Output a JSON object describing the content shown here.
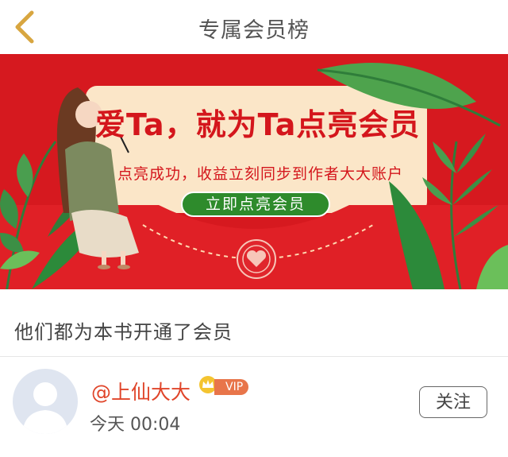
{
  "header": {
    "title": "专属会员榜",
    "back_icon": "chevron-left-icon"
  },
  "banner": {
    "headline": "爱Ta，就为Ta点亮会员",
    "subtext": "点亮成功，收益立刻同步到作者大大账户",
    "button_label": "立即点亮会员"
  },
  "section": {
    "title": "他们都为本书开通了会员"
  },
  "members": [
    {
      "name": "@上仙大大",
      "badge": "VIP",
      "time": "今天 00:04",
      "follow_label": "关注"
    }
  ],
  "colors": {
    "banner_red": "#d6191f",
    "accent_green": "#2e8b2c",
    "name_color": "#e0452a",
    "vip_orange": "#e8754a",
    "back_gold": "#d8a640"
  }
}
